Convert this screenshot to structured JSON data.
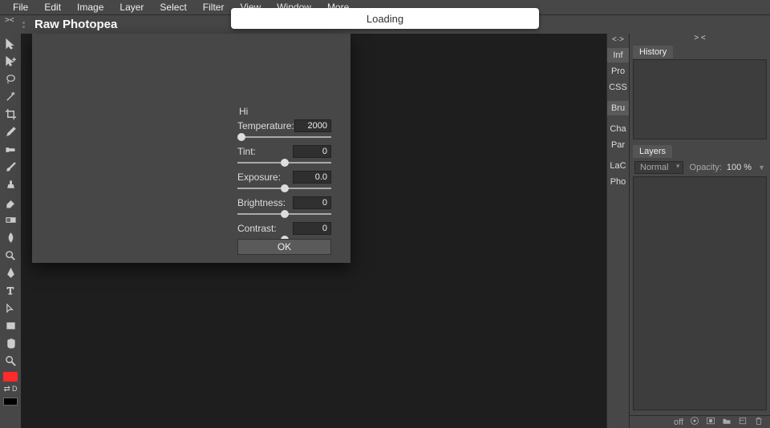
{
  "menu": {
    "items": [
      "File",
      "Edit",
      "Image",
      "Layer",
      "Select",
      "Filter",
      "View",
      "Window",
      "More"
    ]
  },
  "topbar": {
    "mini": "><",
    "title": "Raw Photopea"
  },
  "loading": {
    "text": "Loading"
  },
  "tools": [
    "move",
    "select-plus",
    "lasso",
    "magic-wand",
    "crop",
    "eyedropper",
    "healing-brush",
    "brush",
    "clone-stamp",
    "eraser",
    "gradient",
    "blur",
    "dodge",
    "pen",
    "text",
    "path-select",
    "rectangle",
    "hand",
    "zoom"
  ],
  "swatch": {
    "label": "D"
  },
  "tabstrip": {
    "arrow": "<·>",
    "items": [
      "Inf",
      "Pro",
      "CSS"
    ],
    "items2": [
      "Bru"
    ],
    "items3": [
      "Cha",
      "Par"
    ],
    "items4": [
      "LaC",
      "Pho"
    ]
  },
  "panels": {
    "right_arrow": "> <",
    "history": {
      "tab": "History"
    },
    "layers": {
      "tab": "Layers",
      "blend": "Normal",
      "opacity_label": "Opacity:",
      "opacity_value": "100 %"
    }
  },
  "footer": {
    "off": "off"
  },
  "dialog": {
    "hi": "Hi",
    "params": [
      {
        "label": "Temperature:",
        "value": "2000",
        "pos": 4
      },
      {
        "label": "Tint:",
        "value": "0",
        "pos": 50
      },
      {
        "label": "Exposure:",
        "value": "0.0",
        "pos": 50
      },
      {
        "label": "Brightness:",
        "value": "0",
        "pos": 50
      },
      {
        "label": "Contrast:",
        "value": "0",
        "pos": 50
      }
    ],
    "ok": "OK"
  }
}
